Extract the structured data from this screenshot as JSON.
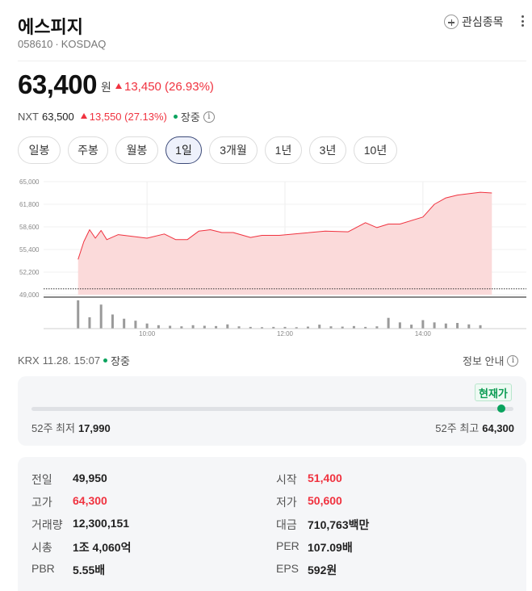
{
  "header": {
    "name": "에스피지",
    "code": "058610",
    "market": "KOSDAQ",
    "watch_label": "관심종목"
  },
  "price": {
    "current": "63,400",
    "unit": "원",
    "change": "13,450 (26.93%)",
    "direction": "up"
  },
  "nxt": {
    "label": "NXT",
    "price": "63,500",
    "change": "13,550 (27.13%)",
    "status": "장중"
  },
  "tabs": [
    {
      "label": "일봉",
      "active": false
    },
    {
      "label": "주봉",
      "active": false
    },
    {
      "label": "월봉",
      "active": false
    },
    {
      "label": "1일",
      "active": true
    },
    {
      "label": "3개월",
      "active": false
    },
    {
      "label": "1년",
      "active": false
    },
    {
      "label": "3년",
      "active": false
    },
    {
      "label": "10년",
      "active": false
    }
  ],
  "chart_data": {
    "type": "area",
    "y_ticks": [
      "65,000",
      "61,800",
      "58,600",
      "55,400",
      "52,200",
      "49,000"
    ],
    "ylim": [
      49000,
      65000
    ],
    "x_ticks": [
      "10:00",
      "12:00",
      "14:00"
    ],
    "prev_close": 49950,
    "x_minutes": [
      0,
      5,
      10,
      15,
      20,
      25,
      35,
      45,
      60,
      75,
      85,
      95,
      105,
      115,
      125,
      135,
      150,
      160,
      175,
      195,
      215,
      235,
      250,
      260,
      270,
      280,
      300,
      310,
      320,
      330,
      340,
      350,
      360
    ],
    "series": [
      {
        "values": [
          54000,
          56500,
          58200,
          57000,
          58100,
          56800,
          57500,
          57300,
          57000,
          57600,
          56800,
          56800,
          58000,
          58200,
          57800,
          57800,
          57100,
          57400,
          57400,
          57700,
          58000,
          57900,
          59200,
          58500,
          59000,
          59000,
          60000,
          61800,
          62700,
          63100,
          63300,
          63500,
          63400
        ]
      }
    ],
    "volume": [
      100,
      40,
      85,
      50,
      35,
      28,
      18,
      12,
      10,
      8,
      12,
      10,
      9,
      15,
      8,
      6,
      5,
      6,
      6,
      5,
      7,
      14,
      8,
      7,
      9,
      6,
      8,
      38,
      22,
      14,
      30,
      22,
      18,
      20,
      15,
      12
    ],
    "colors": {
      "line": "#f0323f",
      "fill": "#fbdada",
      "volume": "#9a9a9a"
    }
  },
  "footer": {
    "exchange": "KRX",
    "time": "11.28. 15:07",
    "status": "장중",
    "info_label": "정보 안내"
  },
  "range52": {
    "badge": "현재가",
    "low_label": "52주 최저",
    "low_value": "17,990",
    "high_label": "52주 최고",
    "high_value": "64,300",
    "position": 0.975
  },
  "stats": {
    "left": [
      {
        "label": "전일",
        "value": "49,950",
        "color": ""
      },
      {
        "label": "고가",
        "value": "64,300",
        "color": "red"
      },
      {
        "label": "거래량",
        "value": "12,300,151",
        "color": ""
      },
      {
        "label": "시총",
        "value": "1조 4,060억",
        "color": ""
      },
      {
        "label": "PBR",
        "value": "5.55배",
        "color": ""
      }
    ],
    "right": [
      {
        "label": "시작",
        "value": "51,400",
        "color": "red"
      },
      {
        "label": "저가",
        "value": "50,600",
        "color": "red"
      },
      {
        "label": "대금",
        "value": "710,763백만",
        "color": ""
      },
      {
        "label": "PER",
        "value": "107.09배",
        "color": ""
      },
      {
        "label": "EPS",
        "value": "592원",
        "color": ""
      }
    ]
  }
}
